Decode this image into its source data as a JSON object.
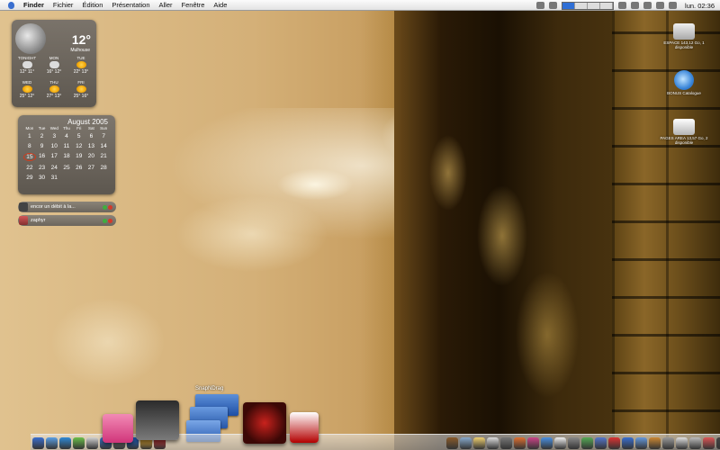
{
  "menubar": {
    "items": [
      "Finder",
      "Fichier",
      "Édition",
      "Présentation",
      "Aller",
      "Fenêtre",
      "Aide"
    ],
    "clock": "lun. 02:36"
  },
  "weather": {
    "temp": "12°",
    "city": "Mulhouse",
    "row1": [
      {
        "day": "TONIGHT",
        "temps": "12° 11°"
      },
      {
        "day": "MON",
        "temps": "16° 12°"
      },
      {
        "day": "TUE",
        "temps": "22° 13°"
      }
    ],
    "row2": [
      {
        "day": "WED",
        "temps": "25° 12°"
      },
      {
        "day": "THU",
        "temps": "27° 13°"
      },
      {
        "day": "FRI",
        "temps": "25° 16°"
      }
    ]
  },
  "calendar": {
    "title": "August 2005",
    "weekdays": [
      "Mon",
      "Tue",
      "Wed",
      "Thu",
      "Fri",
      "Sat",
      "Sun"
    ],
    "days": [
      "1",
      "2",
      "3",
      "4",
      "5",
      "6",
      "7",
      "8",
      "9",
      "10",
      "11",
      "12",
      "13",
      "14",
      "15",
      "16",
      "17",
      "18",
      "19",
      "20",
      "21",
      "22",
      "23",
      "24",
      "25",
      "26",
      "27",
      "28",
      "29",
      "30",
      "31"
    ],
    "today": "15"
  },
  "messages": [
    {
      "text": "encor un débit à la..."
    },
    {
      "text": "zaphyr"
    }
  ],
  "disks": [
    {
      "label": "ESPACE 143,12 Go, 1 disponible"
    },
    {
      "label": "BONUS Catalogue"
    },
    {
      "label": "PAGES AREA 13,57 Go, 2 disponible"
    }
  ],
  "stack": {
    "label": "SnapNDrag"
  },
  "dock_colors": [
    "#3a6fd0",
    "#5aa0e6",
    "#2f8ad8",
    "#6cc04a",
    "#d0d0d0",
    "#3e7ad4",
    "#9a9a9a",
    "#2266cc",
    "#f0b030",
    "#cc3333",
    "#8a5a2a",
    "#88aacc",
    "#f0d070",
    "#dddddd",
    "#777777",
    "#e07030",
    "#cc4488",
    "#4a90e2",
    "#f0f0f0",
    "#888888",
    "#55aa55",
    "#5577cc",
    "#dd3333",
    "#3a6fd0",
    "#6699dd",
    "#cc8833",
    "#999999",
    "#e0e0e0",
    "#bbbbbb",
    "#dd5555",
    "#444444"
  ]
}
